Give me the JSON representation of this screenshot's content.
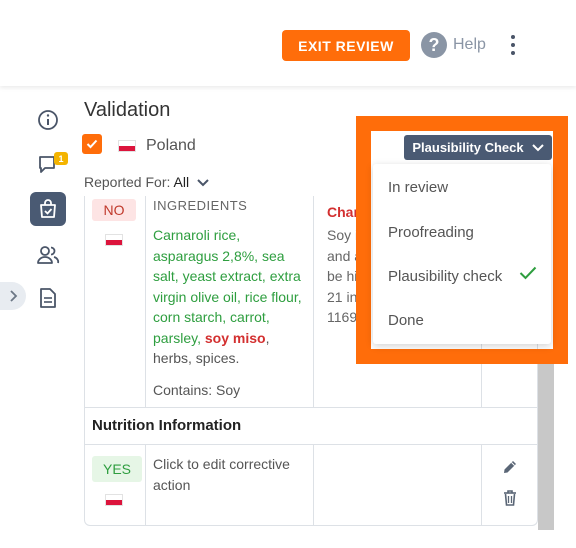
{
  "header": {
    "exit_review": "EXIT REVIEW",
    "help": "Help",
    "help_icon_glyph": "?"
  },
  "sidebar": {
    "comments_badge": "1",
    "icons": [
      "info-icon",
      "comment-icon",
      "shopping-bag-check-icon",
      "users-icon",
      "document-icon"
    ]
  },
  "validation": {
    "title": "Validation",
    "country": "Poland",
    "reported_for_label": "Reported For:",
    "reported_for_value": "All"
  },
  "table": {
    "row1": {
      "status": "NO",
      "ingredients_header": "INGREDIENTS",
      "ingredients_green": "Carnaroli rice, asparagus 2,8%, sea salt, yeast extract, extra virgin olive oil, rice flour, corn starch, carrot, parsley, ",
      "ingredients_allergen": "soy miso",
      "ingredients_tail": ", herbs, spices.",
      "contains": "Contains: Soy",
      "col3_header": "Chan",
      "col3_lines": [
        "Soy i",
        "and a",
        "be hi",
        "21 in",
        "1169"
      ]
    },
    "section": "Nutrition Information",
    "row2": {
      "status": "YES",
      "corrective": "Click to edit corrective action"
    }
  },
  "status_dropdown": {
    "selected": "Plausibility Check",
    "options": [
      "In review",
      "Proofreading",
      "Plausibility check",
      "Done"
    ],
    "checked_index": 2
  },
  "colors": {
    "accent": "#ff6d0a",
    "slate": "#4a5a73",
    "success": "#2e9e3f",
    "danger": "#d32f2f"
  }
}
